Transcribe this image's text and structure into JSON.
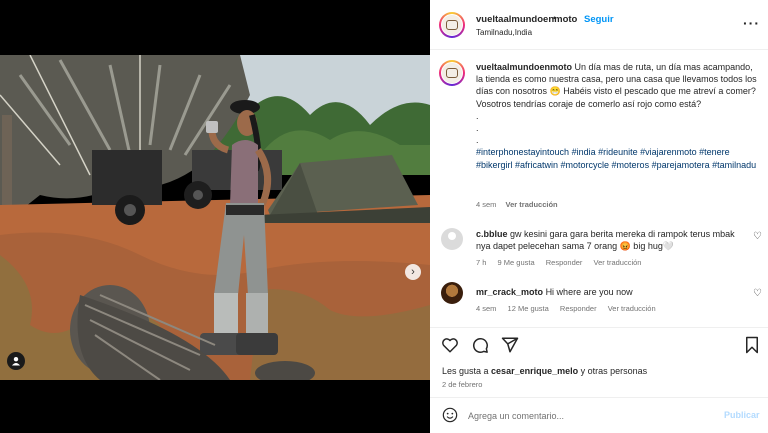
{
  "post": {
    "username": "vueltaalmundoenmoto",
    "separator": "•",
    "follow_label": "Seguir",
    "location": "Tamilnadu,India",
    "more_icon": "more-horizontal-icon",
    "caption_user": "vueltaalmundoenmoto",
    "caption_text": "Un día mas de ruta, un día mas acampando, la tienda es como nuestra casa, pero una casa que llevamos todos los días con nosotros 😁 Habéis visto el pescado que me atreví a comer? Vosotros tendrías coraje de comerlo así rojo como está?",
    "caption_dots": [
      ".",
      ".",
      "."
    ],
    "hashtags": "#interphonestayintouch #india #rideunite #viajarenmoto #tenere #bikergirl #africatwin #motorcycle #moteros #parejamotera #tamilnadu",
    "caption_time": "4 sem",
    "caption_translate": "Ver traducción",
    "likes_text_prefix": "Les gusta a ",
    "likes_user": "cesar_enrique_melo",
    "likes_text_suffix": " y otras personas",
    "date": "2 de febrero"
  },
  "comments": [
    {
      "user": "c.bblue",
      "text": "gw kesini gara gara berita mereka di rampok terus mbak nya dapet pelecehan sama 7 orang 😡 big hug🤍",
      "time": "7 h",
      "likes": "9 Me gusta",
      "reply": "Responder",
      "translate": "Ver traducción"
    },
    {
      "user": "mr_crack_moto",
      "text": "Hi where are you now",
      "time": "4 sem",
      "likes": "12 Me gusta",
      "reply": "Responder",
      "translate": "Ver traducción"
    }
  ],
  "actions": {
    "like_icon": "heart-icon",
    "comment_icon": "comment-icon",
    "share_icon": "send-icon",
    "save_icon": "bookmark-icon"
  },
  "composer": {
    "emoji_icon": "emoji-icon",
    "placeholder": "Agrega un comentario...",
    "publish_label": "Publicar"
  },
  "media": {
    "slide_count": 6,
    "active_slide": 1,
    "next_icon": "chevron-right-icon",
    "tag_icon": "user-tag-icon"
  },
  "colors": {
    "link": "#0095f6",
    "hashtag": "#00376b",
    "muted": "#737373",
    "publish_disabled": "#b3dbff"
  }
}
